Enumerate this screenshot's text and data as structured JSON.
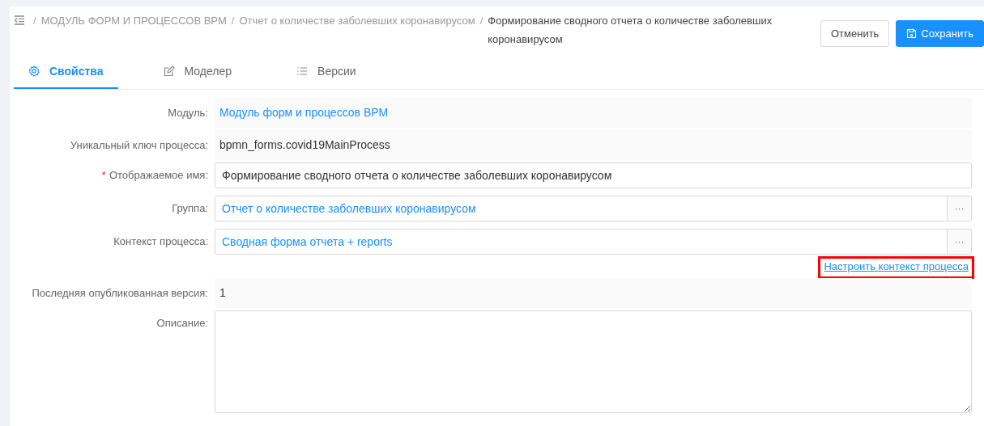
{
  "breadcrumb": [
    {
      "separator": "/",
      "label": "МОДУЛЬ ФОРМ И ПРОЦЕССОВ BPM",
      "current": false
    },
    {
      "separator": "/",
      "label": "Отчет о количестве заболевших коронавирусом",
      "current": false
    },
    {
      "separator": "/",
      "label": "Формирование сводного отчета о количестве заболевших коронавирусом",
      "current": true
    }
  ],
  "buttons": [
    {
      "label": "Отменить",
      "kind": "default"
    },
    {
      "label": "Сохранить",
      "kind": "primary"
    }
  ],
  "tabs": [
    {
      "label": "Свойства",
      "selected": true
    },
    {
      "label": "Моделер",
      "selected": false
    },
    {
      "label": "Версии",
      "selected": false
    }
  ],
  "fields": [
    {
      "kind": "readonly-link",
      "label": "Модуль:",
      "value": "Модуль форм и процессов BPM"
    },
    {
      "kind": "readonly-text",
      "label": "Уникальный ключ процесса:",
      "value": "bpmn_forms.covid19MainProcess"
    },
    {
      "kind": "input",
      "required_mark": "*",
      "label": "Отображаемое имя:",
      "value": "Формирование сводного отчета о количестве заболевших коронавирусом"
    },
    {
      "kind": "picker",
      "label": "Группа:",
      "value": "Отчет о количестве заболевших коронавирусом",
      "picker_button": "···"
    },
    {
      "kind": "picker",
      "label": "Контекст процесса:",
      "value": "Сводная форма отчета + reports",
      "picker_button": "···"
    },
    {
      "kind": "action-link",
      "label_link": "Настроить контекст процесса",
      "highlighted": true
    },
    {
      "kind": "readonly-text",
      "label": "Последняя опубликованная версия:",
      "value": "1"
    },
    {
      "kind": "textarea",
      "label": "Описание:"
    }
  ]
}
